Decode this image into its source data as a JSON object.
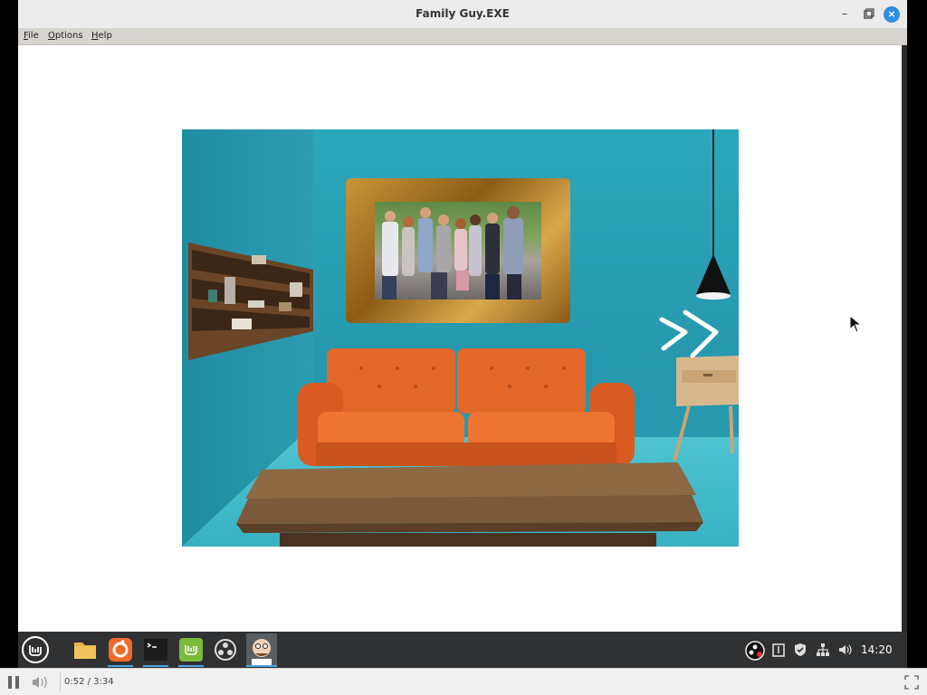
{
  "window": {
    "title": "Family Guy.EXE",
    "controls": {
      "minimize": "–",
      "maximize": "▢",
      "close": "×"
    }
  },
  "menubar": {
    "items": [
      {
        "label": "File",
        "mnemonic": "F"
      },
      {
        "label": "Options",
        "mnemonic": "O"
      },
      {
        "label": "Help",
        "mnemonic": "H"
      }
    ]
  },
  "scene": {
    "next_arrows": ">>"
  },
  "taskbar": {
    "apps": [
      "linux-mint-menu-icon",
      "files-icon",
      "firefox-icon",
      "terminal-icon",
      "mint-update-icon",
      "obs-icon",
      "family-guy-icon"
    ],
    "clock": "14:20"
  },
  "player": {
    "time": "0:52 / 3:34"
  },
  "colors": {
    "wall": "#2a9fb3",
    "sofa": "#e2662a",
    "taskbar": "#2f3133",
    "close_button": "#2f8fe0"
  }
}
